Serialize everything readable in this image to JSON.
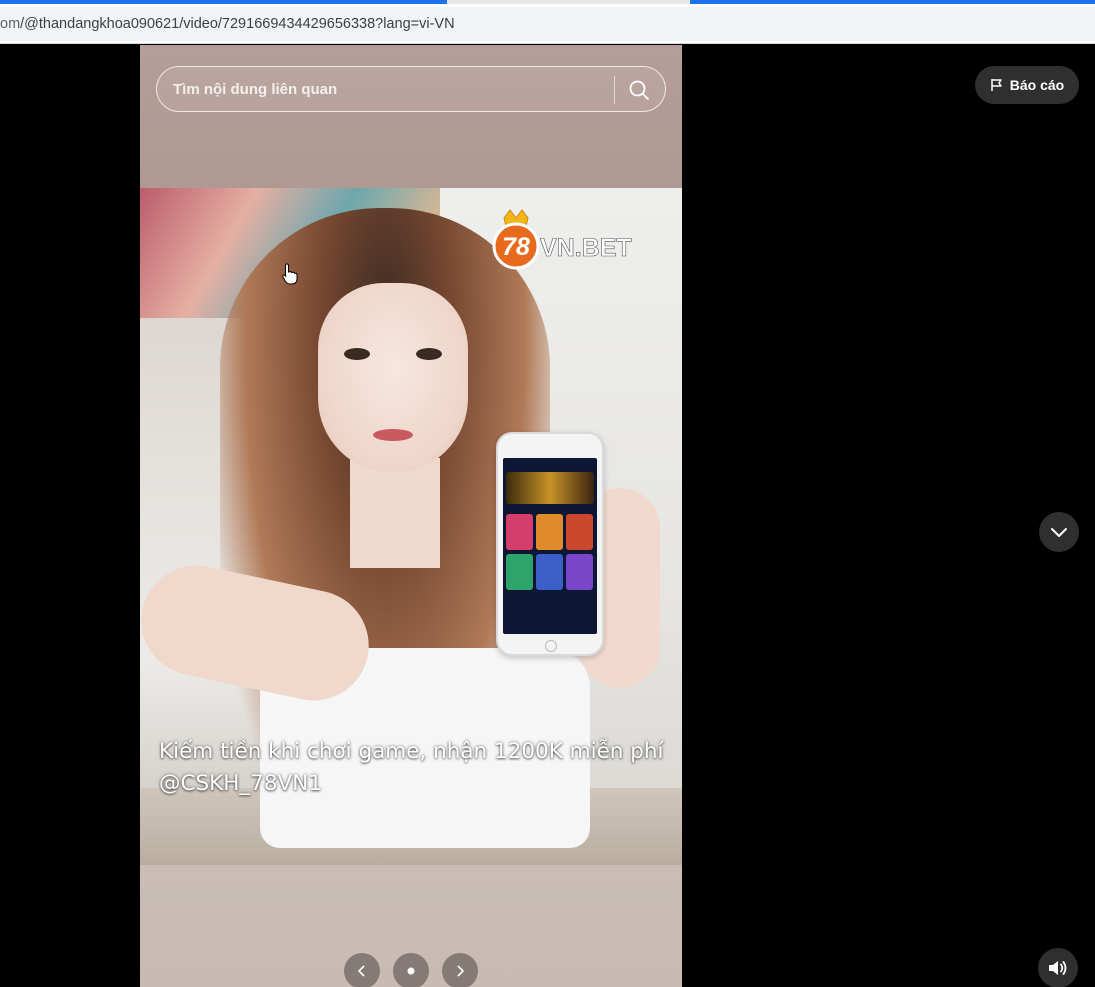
{
  "browser": {
    "url": {
      "host": "om",
      "path": "/@thandangkhoa090621/video/7291669434429656338?lang=vi-VN"
    }
  },
  "search": {
    "placeholder": "Tìm nội dung liên quan",
    "icon": "search-icon"
  },
  "video": {
    "logo_text": {
      "number": "78",
      "suffix": "VN.BET"
    },
    "caption": {
      "line1": "Kiếm tiền khi chơi game, nhận 1200K miễn phí",
      "line2": "@CSKH_78VN1"
    }
  },
  "controls": {
    "report_label": "Báo cáo",
    "report_icon": "flag-icon",
    "next_icon": "chevron-down-icon",
    "volume_icon": "volume-icon",
    "prev_slide_icon": "chevron-left-icon",
    "next_slide_icon": "chevron-right-icon",
    "slide_dot_icon": "dot-icon"
  },
  "colors": {
    "accent_blue": "#1a73e8",
    "panel_dark": "#2f2f2f",
    "logo_orange": "#e86a1c",
    "crown_gold": "#f2b61b"
  }
}
